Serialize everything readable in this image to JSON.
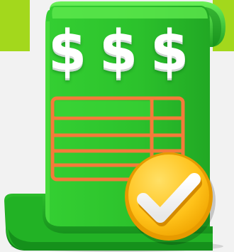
{
  "illustration": {
    "icon": "invoice-with-check-icon",
    "currency_symbols": [
      "$",
      "$",
      "$"
    ],
    "colors": {
      "background": "#f2f2f2",
      "accent_lime": "#a3d81c",
      "bill_green": "#2ec42e",
      "bill_green_light": "#55e64a",
      "bill_green_dark": "#128a1a",
      "table_orange": "#f57a3a",
      "badge_yellow": "#ffc21a",
      "badge_yellow_dark": "#e59a00",
      "check_white": "#ffffff"
    }
  }
}
